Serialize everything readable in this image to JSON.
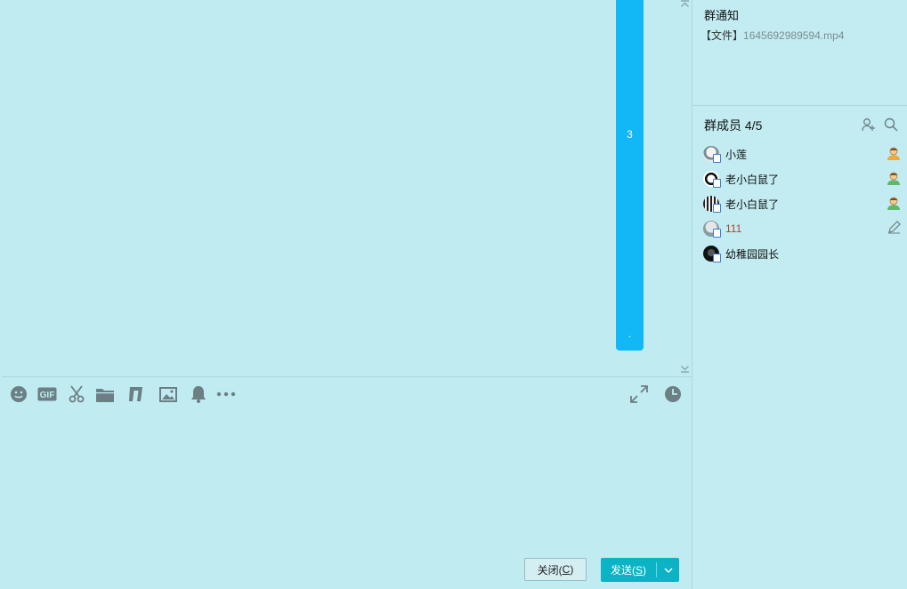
{
  "message": {
    "bubble_number": "3",
    "bubble_tail": "."
  },
  "toolbar": {
    "icons": [
      "emoji-icon",
      "gif-icon",
      "scissors-icon",
      "folder-icon",
      "music-icon",
      "image-icon",
      "bell-icon",
      "more-icon",
      "expand-icon",
      "clock-icon"
    ]
  },
  "input": {
    "value": "",
    "placeholder": ""
  },
  "buttons": {
    "close_label": "关闭(",
    "close_key": "C",
    "close_end": ")",
    "send_label": "发送(",
    "send_key": "S",
    "send_end": ")"
  },
  "notice": {
    "title": "群通知",
    "prefix": "【文件】",
    "file": "1645692989594.mp4"
  },
  "members": {
    "title": "群成员 4/5",
    "list": [
      {
        "name": "小莲",
        "badge": "admin-icon",
        "color": "#111111"
      },
      {
        "name": "老小白鼠了",
        "badge": "member-icon",
        "color": "#111111"
      },
      {
        "name": "老小白鼠了",
        "badge": "member-icon",
        "color": "#111111"
      },
      {
        "name": "111",
        "badge": "edit-icon",
        "color": "#b5422c"
      },
      {
        "name": "幼稚园园长",
        "badge": "",
        "color": "#111111"
      }
    ]
  },
  "colors": {
    "background": "#c0ebf0",
    "bubble": "#12b7f5",
    "send_button": "#0bb3c4"
  }
}
